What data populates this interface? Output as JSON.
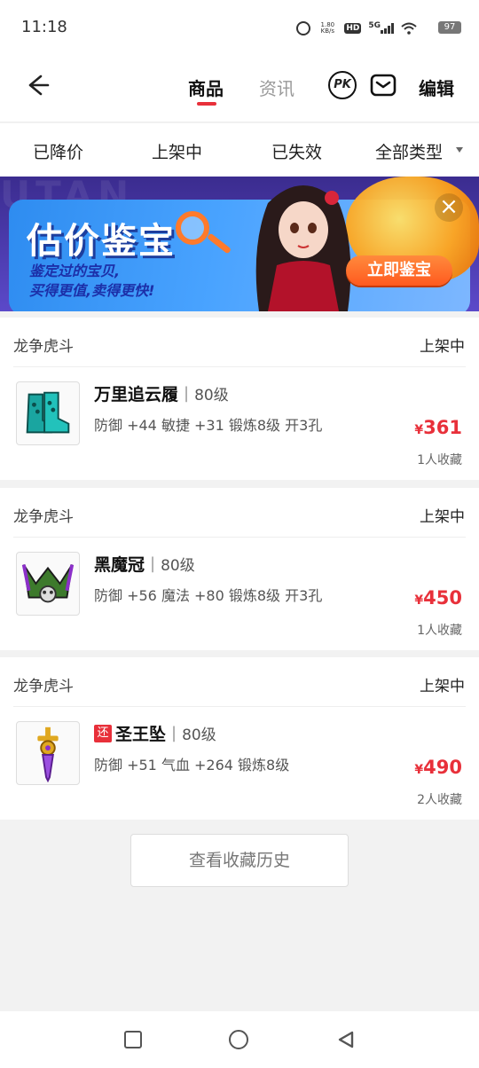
{
  "status_bar": {
    "time": "11:18",
    "net_speed": "1.80 KB/s",
    "hd": "HD",
    "network": "5G",
    "battery": "97"
  },
  "header": {
    "tabs": [
      {
        "label": "商品",
        "active": true
      },
      {
        "label": "资讯",
        "active": false
      }
    ],
    "pk_label": "PK",
    "edit_label": "编辑"
  },
  "filters": [
    "已降价",
    "上架中",
    "已失效",
    "全部类型"
  ],
  "banner": {
    "title": "估价鉴宝",
    "subtitle_line1": "鉴定过的宝贝,",
    "subtitle_line2": "买得更值,卖得更快!",
    "cta": "立即鉴宝",
    "bg_text": "UTAN"
  },
  "items": [
    {
      "server": "龙争虎斗",
      "status": "上架中",
      "name": "万里追云履",
      "level": "80级",
      "attrs": "防御 +44 敏捷 +31 锻炼8级 开3孔",
      "price": "361",
      "currency": "¥",
      "favorites": "1人收藏",
      "badge": ""
    },
    {
      "server": "龙争虎斗",
      "status": "上架中",
      "name": "黑魔冠",
      "level": "80级",
      "attrs": "防御 +56 魔法 +80 锻炼8级 开3孔",
      "price": "450",
      "currency": "¥",
      "favorites": "1人收藏",
      "badge": ""
    },
    {
      "server": "龙争虎斗",
      "status": "上架中",
      "name": "圣王坠",
      "level": "80级",
      "attrs": "防御 +51 气血 +264 锻炼8级",
      "price": "490",
      "currency": "¥",
      "favorites": "2人收藏",
      "badge": "还"
    }
  ],
  "history_button": "查看收藏历史",
  "colors": {
    "accent": "#e8303a",
    "banner_blue": "#2e8cf0",
    "cta_orange": "#ff5a1f"
  }
}
